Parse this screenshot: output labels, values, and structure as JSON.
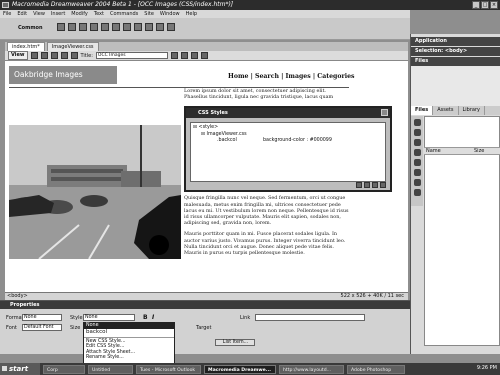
{
  "window": {
    "title": "Macromedia Dreamweaver 2004 Beta 1 - [OCC Images (CSS/index.htm*)]"
  },
  "menu": [
    "File",
    "Edit",
    "View",
    "Insert",
    "Modify",
    "Text",
    "Commands",
    "Site",
    "Window",
    "Help"
  ],
  "toolbar": {
    "insert_label": "Common"
  },
  "tabs": [
    "index.htm*",
    "ImageViewer.css"
  ],
  "doc_toolbar": {
    "view_label": "View",
    "title_label": "Title:",
    "title_value": "OCC Images"
  },
  "page": {
    "header": "Oakbridge Images",
    "nav": "Home | Search | Images | Categories",
    "paragraphs": [
      "Lorem ipsum dolor sit amet, consectetuer adipiscing elit. Phasellus tincidunt, ligula nec gravida tristique, lacus quam",
      "Quisque fringilla nunc vel neque. Sed fermentum, orci ut congue malesuada, metus enim fringilla mi, ultrices consectetuer pede lacus eu mi. Ut vestibulum lorem non neque. Pellentesque id risus id risus ullamcorper vulputate. Mauris elit sapien, sodales non, adipiscing sed, gravida non, lorem.",
      "Mauris porttitor quam in mi. Fusce placerat sodales ligula. In auctor varius justo. Vivamus purus. Integer viverra tincidunt leo. Nulla tincidunt orci et augue. Donec aliquet pede vitae felis. Mauris in purus eu turpis pellentesque molestie."
    ]
  },
  "status": {
    "tag": "<body>",
    "size": "522 x 526 + 40K / 11 sec"
  },
  "css_panel": {
    "title": "CSS Styles",
    "tree": [
      "<style>",
      "ImageViewer.css",
      ".backcol"
    ],
    "value": "background-color : #000099"
  },
  "right_panel": {
    "application": "Application",
    "selection": "Selection: <body>",
    "files": "Files",
    "file_tabs": [
      "Files",
      "Assets",
      "Library"
    ],
    "col_name": "Name",
    "col_size": "Size"
  },
  "properties": {
    "title": "Properties",
    "format_label": "Format",
    "format_value": "None",
    "style_label": "Style",
    "style_value": "None",
    "font_label": "Font",
    "font_value": "Default Font",
    "size_label": "Size",
    "link_label": "Link",
    "target_label": "Target",
    "list_item": "List Item..."
  },
  "style_dropdown": [
    "None",
    "backcol",
    "New CSS Style...",
    "Edit CSS Style...",
    "Attach Style Sheet...",
    "Rename Style..."
  ],
  "taskbar": {
    "start": "start",
    "tasks": [
      "Corp",
      "Untitled",
      "Tues - Microsoft Outlook",
      "Macromedia Dreamwe...",
      "http://www.layoutd...",
      "Adobe Photoshop"
    ],
    "clock": "9:26 PM"
  }
}
